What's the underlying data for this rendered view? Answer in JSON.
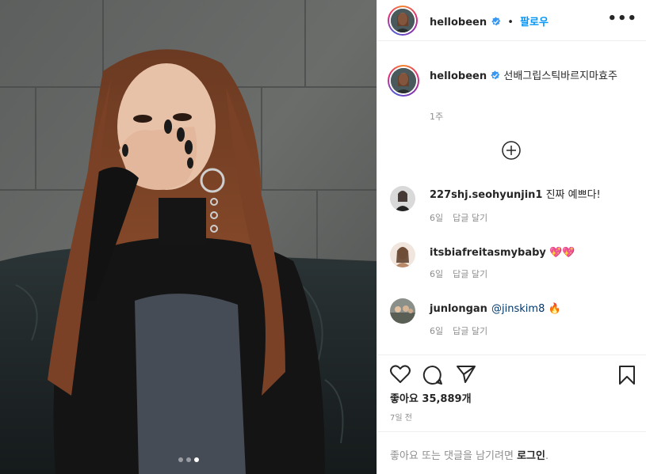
{
  "post": {
    "username": "hellobeen",
    "follow_label": "팔로우",
    "separator": "•",
    "more_label": "•••",
    "caption": "선배그립스틱바르지마효주",
    "caption_age": "1주",
    "likes_label": "좋아요 35,889개",
    "date": "7일 전"
  },
  "comments": [
    {
      "username": "227shj.seohyunjin1",
      "text": " 진짜 예쁘다!",
      "age": "6일",
      "reply": "답글 달기"
    },
    {
      "username": "itsbiafreitasmybaby",
      "text": " 💖💖",
      "age": "6일",
      "reply": "답글 달기"
    },
    {
      "username": "junlongan",
      "mention": "@jinskim8",
      "text": " 🔥",
      "age": "6일",
      "reply": "답글 달기"
    }
  ],
  "footer": {
    "prompt": "좋아요 또는 댓글을 남기려면 ",
    "login_label": "로그인",
    "suffix": "."
  },
  "carousel": {
    "count": 3,
    "active_index": 2
  },
  "colors": {
    "accent": "#0095f6",
    "verified": "#3897f0",
    "muted": "#8e8e8e",
    "text": "#262626"
  },
  "icons": [
    "verified-badge-icon",
    "more-options-icon",
    "add-comment-icon",
    "heart-icon",
    "comment-icon",
    "share-icon",
    "bookmark-icon"
  ]
}
